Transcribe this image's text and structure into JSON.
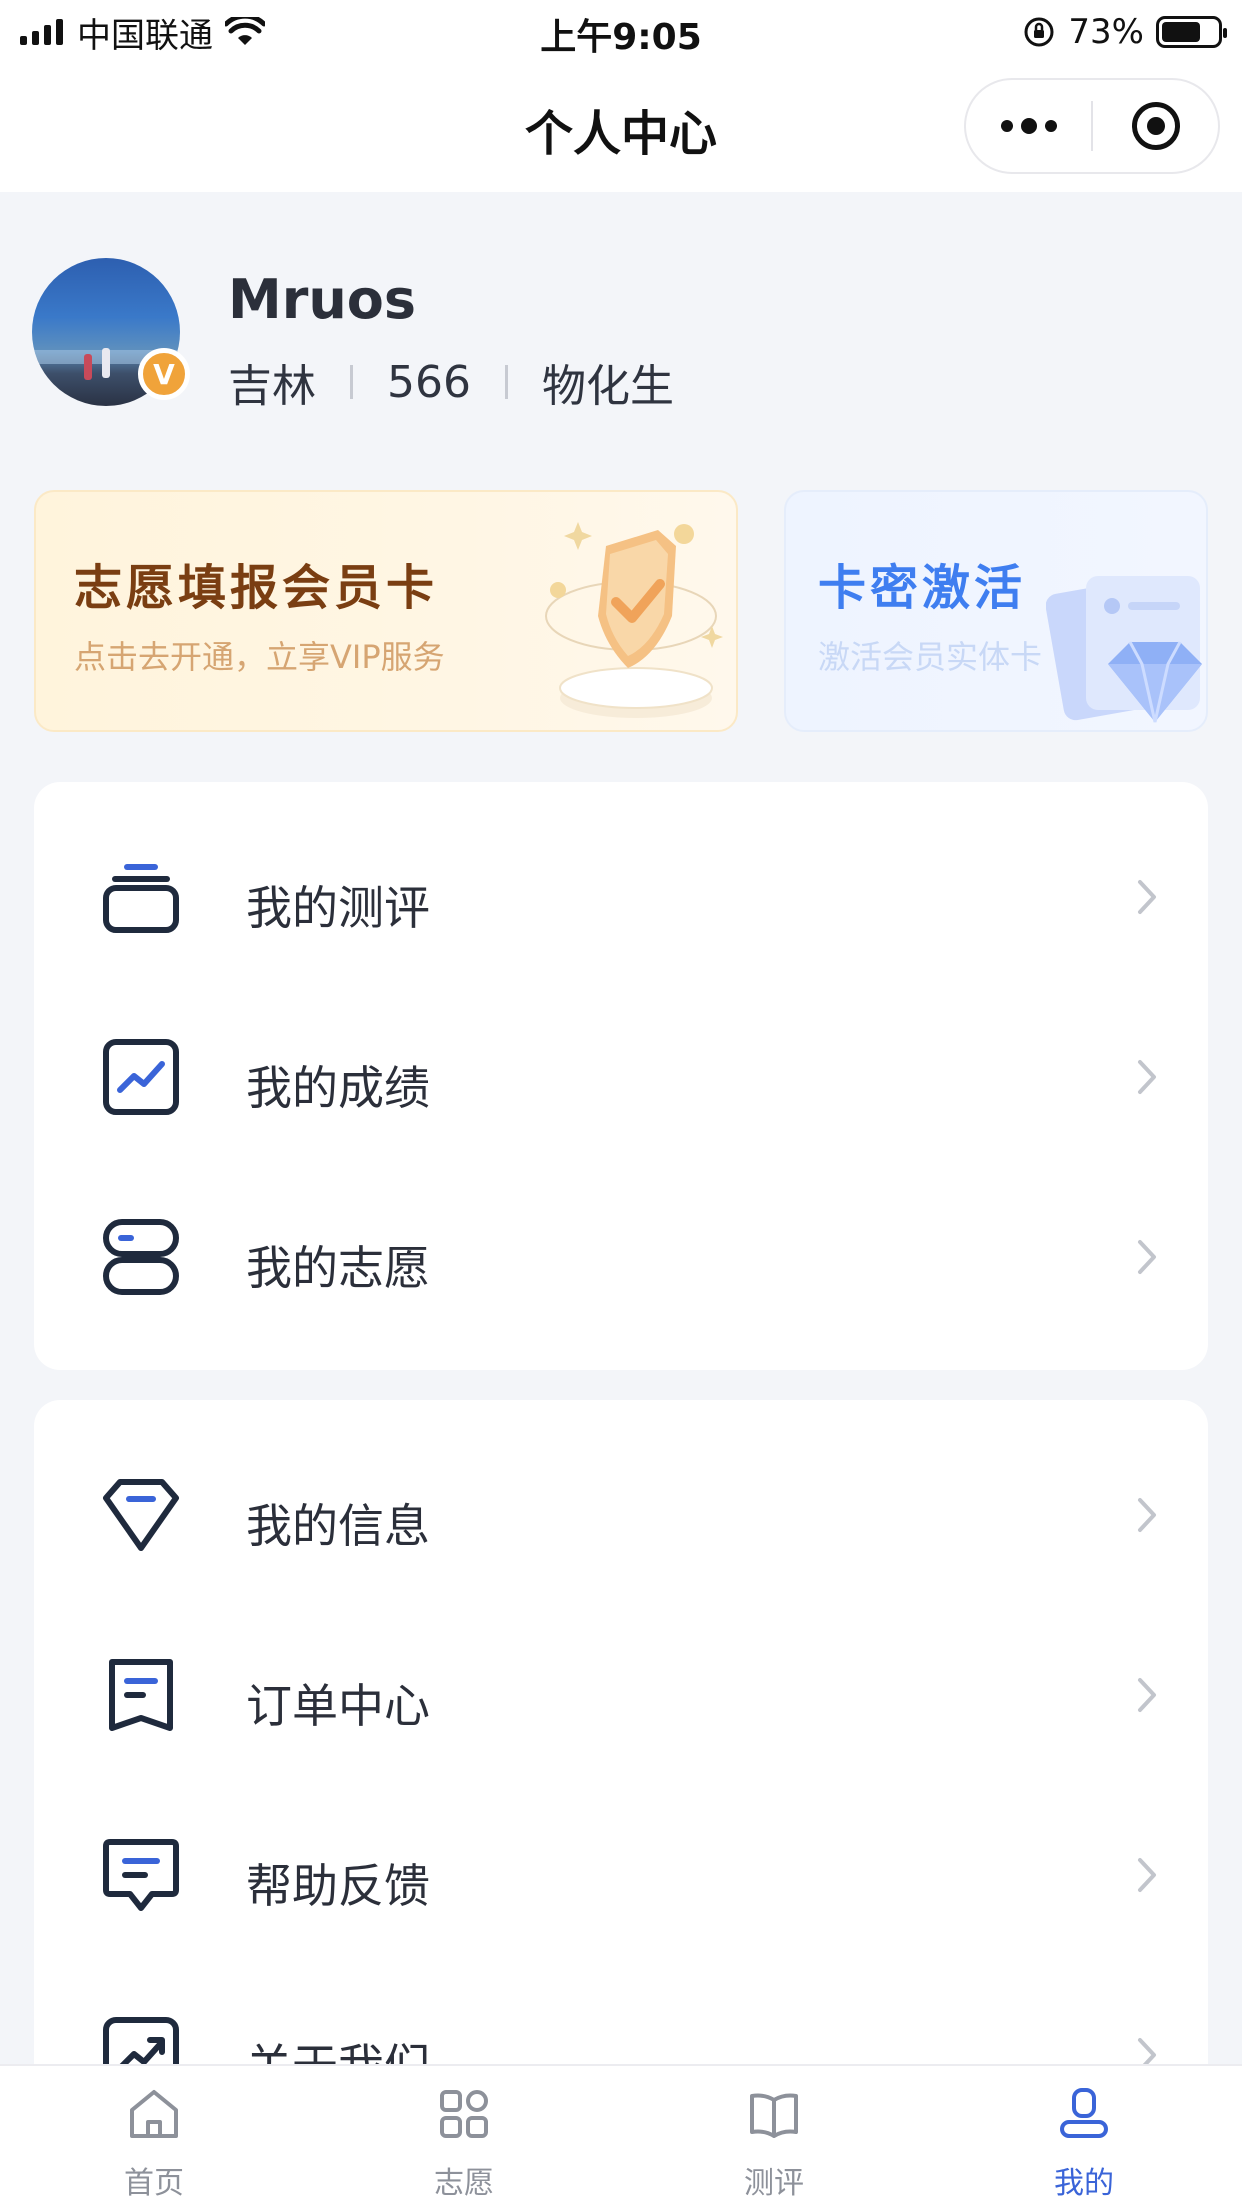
{
  "status_bar": {
    "carrier": "中国联通",
    "time": "上午9:05",
    "battery": "73%"
  },
  "nav": {
    "title": "个人中心"
  },
  "profile": {
    "name": "Mruos",
    "badge": "V",
    "province": "吉林",
    "score": "566",
    "subjects": "物化生"
  },
  "vip_card": {
    "title": "志愿填报会员卡",
    "subtitle": "点击去开通，立享VIP服务"
  },
  "activate_card": {
    "title": "卡密激活",
    "subtitle": "激活会员实体卡"
  },
  "menu_group_1": [
    {
      "label": "我的测评",
      "icon": "assessment-icon"
    },
    {
      "label": "我的成绩",
      "icon": "score-chart-icon"
    },
    {
      "label": "我的志愿",
      "icon": "volunteer-list-icon"
    }
  ],
  "menu_group_2": [
    {
      "label": "我的信息",
      "icon": "diamond-icon"
    },
    {
      "label": "订单中心",
      "icon": "order-icon"
    },
    {
      "label": "帮助反馈",
      "icon": "feedback-icon"
    },
    {
      "label": "关于我们",
      "icon": "about-icon"
    }
  ],
  "tabbar": [
    {
      "label": "首页",
      "icon": "home-icon"
    },
    {
      "label": "志愿",
      "icon": "grid-icon"
    },
    {
      "label": "测评",
      "icon": "book-icon"
    },
    {
      "label": "我的",
      "icon": "user-icon",
      "active": true
    }
  ],
  "colors": {
    "accent": "#3a64d8",
    "icon_dark": "#1f2a3d",
    "vip_title": "#7a3e12",
    "activate_title": "#3f7ef0"
  }
}
